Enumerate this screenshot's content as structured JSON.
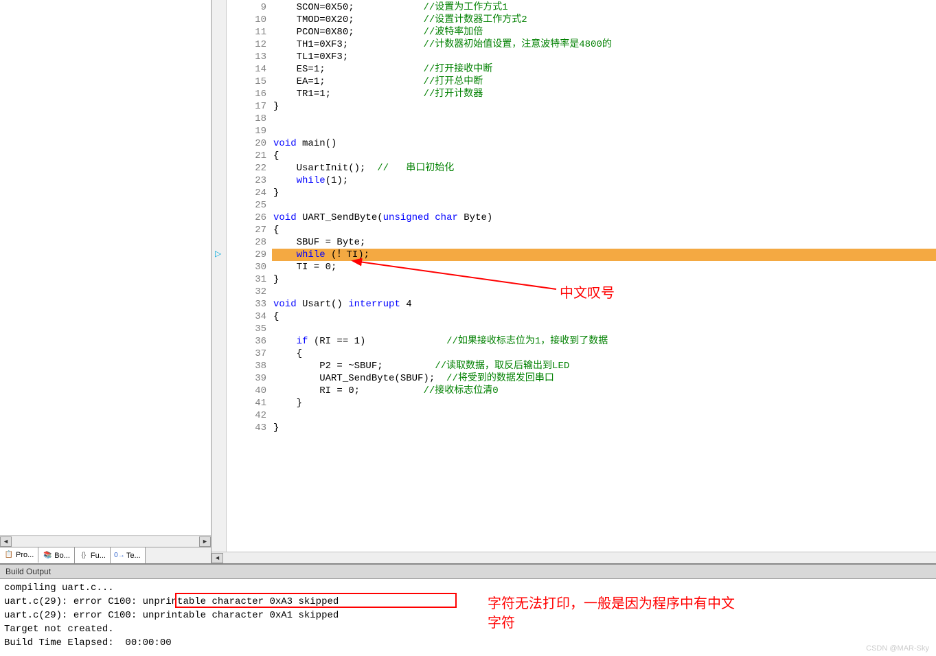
{
  "leftTabs": [
    {
      "icon": "📋",
      "label": "Pro...",
      "iconColor": "#4a9"
    },
    {
      "icon": "📚",
      "label": "Bo...",
      "iconColor": "#36c"
    },
    {
      "icon": "{}",
      "label": "Fu...",
      "iconColor": "#666"
    },
    {
      "icon": "0→",
      "label": "Te...",
      "iconColor": "#36c"
    }
  ],
  "code": {
    "lines": [
      {
        "n": 9,
        "segs": [
          {
            "t": "    SCON=",
            "c": "id"
          },
          {
            "t": "0X50",
            "c": "num"
          },
          {
            "t": ";            ",
            "c": "id"
          },
          {
            "t": "//设置为工作方式1",
            "c": "cm"
          }
        ]
      },
      {
        "n": 10,
        "segs": [
          {
            "t": "    TMOD=",
            "c": "id"
          },
          {
            "t": "0X20",
            "c": "num"
          },
          {
            "t": ";            ",
            "c": "id"
          },
          {
            "t": "//设置计数器工作方式2",
            "c": "cm"
          }
        ]
      },
      {
        "n": 11,
        "segs": [
          {
            "t": "    PCON=",
            "c": "id"
          },
          {
            "t": "0X80",
            "c": "num"
          },
          {
            "t": ";            ",
            "c": "id"
          },
          {
            "t": "//波特率加倍",
            "c": "cm"
          }
        ]
      },
      {
        "n": 12,
        "segs": [
          {
            "t": "    TH1=",
            "c": "id"
          },
          {
            "t": "0XF3",
            "c": "num"
          },
          {
            "t": ";             ",
            "c": "id"
          },
          {
            "t": "//计数器初始值设置，注意波特率是4800的",
            "c": "cm"
          }
        ]
      },
      {
        "n": 13,
        "segs": [
          {
            "t": "    TL1=",
            "c": "id"
          },
          {
            "t": "0XF3",
            "c": "num"
          },
          {
            "t": ";",
            "c": "id"
          }
        ]
      },
      {
        "n": 14,
        "segs": [
          {
            "t": "    ES=",
            "c": "id"
          },
          {
            "t": "1",
            "c": "num"
          },
          {
            "t": ";                 ",
            "c": "id"
          },
          {
            "t": "//打开接收中断",
            "c": "cm"
          }
        ]
      },
      {
        "n": 15,
        "segs": [
          {
            "t": "    EA=",
            "c": "id"
          },
          {
            "t": "1",
            "c": "num"
          },
          {
            "t": ";                 ",
            "c": "id"
          },
          {
            "t": "//打开总中断",
            "c": "cm"
          }
        ]
      },
      {
        "n": 16,
        "segs": [
          {
            "t": "    TR1=",
            "c": "id"
          },
          {
            "t": "1",
            "c": "num"
          },
          {
            "t": ";                ",
            "c": "id"
          },
          {
            "t": "//打开计数器",
            "c": "cm"
          }
        ]
      },
      {
        "n": 17,
        "segs": [
          {
            "t": "}",
            "c": "id"
          }
        ]
      },
      {
        "n": 18,
        "segs": []
      },
      {
        "n": 19,
        "segs": []
      },
      {
        "n": 20,
        "segs": [
          {
            "t": "void",
            "c": "kw"
          },
          {
            "t": " main()",
            "c": "id"
          }
        ]
      },
      {
        "n": 21,
        "segs": [
          {
            "t": "{",
            "c": "id"
          }
        ]
      },
      {
        "n": 22,
        "segs": [
          {
            "t": "    UsartInit();  ",
            "c": "id"
          },
          {
            "t": "//   串口初始化",
            "c": "cm"
          }
        ]
      },
      {
        "n": 23,
        "segs": [
          {
            "t": "    ",
            "c": "id"
          },
          {
            "t": "while",
            "c": "kw"
          },
          {
            "t": "(",
            "c": "id"
          },
          {
            "t": "1",
            "c": "num"
          },
          {
            "t": ");",
            "c": "id"
          }
        ]
      },
      {
        "n": 24,
        "segs": [
          {
            "t": "}",
            "c": "id"
          }
        ]
      },
      {
        "n": 25,
        "segs": []
      },
      {
        "n": 26,
        "segs": [
          {
            "t": "void",
            "c": "kw"
          },
          {
            "t": " UART_SendByte(",
            "c": "id"
          },
          {
            "t": "unsigned",
            "c": "kw"
          },
          {
            "t": " ",
            "c": "id"
          },
          {
            "t": "char",
            "c": "kw"
          },
          {
            "t": " Byte)",
            "c": "id"
          }
        ]
      },
      {
        "n": 27,
        "segs": [
          {
            "t": "{",
            "c": "id"
          }
        ]
      },
      {
        "n": 28,
        "segs": [
          {
            "t": "    SBUF = Byte;",
            "c": "id"
          }
        ]
      },
      {
        "n": 29,
        "hl": true,
        "segs": [
          {
            "t": "    ",
            "c": "id"
          },
          {
            "t": "while",
            "c": "kw"
          },
          {
            "t": " (！TI);",
            "c": "id"
          }
        ]
      },
      {
        "n": 30,
        "segs": [
          {
            "t": "    TI = ",
            "c": "id"
          },
          {
            "t": "0",
            "c": "num"
          },
          {
            "t": ";",
            "c": "id"
          }
        ]
      },
      {
        "n": 31,
        "segs": [
          {
            "t": "}",
            "c": "id"
          }
        ]
      },
      {
        "n": 32,
        "segs": []
      },
      {
        "n": 33,
        "segs": [
          {
            "t": "void",
            "c": "kw"
          },
          {
            "t": " Usart() ",
            "c": "id"
          },
          {
            "t": "interrupt",
            "c": "kw"
          },
          {
            "t": " ",
            "c": "id"
          },
          {
            "t": "4",
            "c": "num"
          }
        ]
      },
      {
        "n": 34,
        "segs": [
          {
            "t": "{",
            "c": "id"
          }
        ]
      },
      {
        "n": 35,
        "segs": []
      },
      {
        "n": 36,
        "segs": [
          {
            "t": "    ",
            "c": "id"
          },
          {
            "t": "if",
            "c": "kw"
          },
          {
            "t": " (RI == ",
            "c": "id"
          },
          {
            "t": "1",
            "c": "num"
          },
          {
            "t": ")              ",
            "c": "id"
          },
          {
            "t": "//如果接收标志位为1，接收到了数据",
            "c": "cm"
          }
        ]
      },
      {
        "n": 37,
        "segs": [
          {
            "t": "    {",
            "c": "id"
          }
        ]
      },
      {
        "n": 38,
        "segs": [
          {
            "t": "        P2 = ~SBUF;         ",
            "c": "id"
          },
          {
            "t": "//读取数据，取反后输出到LED",
            "c": "cm"
          }
        ]
      },
      {
        "n": 39,
        "segs": [
          {
            "t": "        UART_SendByte(SBUF);  ",
            "c": "id"
          },
          {
            "t": "//将受到的数据发回串口",
            "c": "cm"
          }
        ]
      },
      {
        "n": 40,
        "segs": [
          {
            "t": "        RI = ",
            "c": "id"
          },
          {
            "t": "0",
            "c": "num"
          },
          {
            "t": ";           ",
            "c": "id"
          },
          {
            "t": "//接收标志位清0",
            "c": "cm"
          }
        ]
      },
      {
        "n": 41,
        "segs": [
          {
            "t": "    }",
            "c": "id"
          }
        ]
      },
      {
        "n": 42,
        "segs": []
      },
      {
        "n": 43,
        "segs": [
          {
            "t": "}",
            "c": "id"
          }
        ]
      }
    ]
  },
  "annotation1": "中文叹号",
  "outputHeader": "Build Output",
  "outputLines": [
    "compiling uart.c...",
    "uart.c(29): error C100: unprintable character 0xA3 skipped",
    "uart.c(29): error C100: unprintable character 0xA1 skipped",
    "Target not created.",
    "Build Time Elapsed:  00:00:00"
  ],
  "annotation2": "字符无法打印，一般是因为程序中有中文\n字符",
  "watermark": "CSDN @MAR-Sky"
}
